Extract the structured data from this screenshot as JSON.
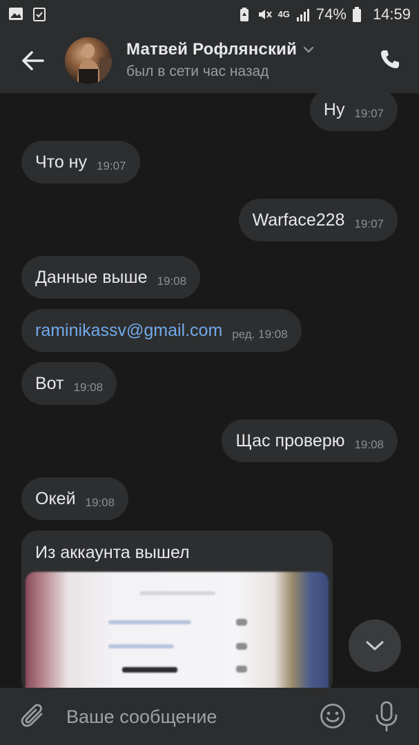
{
  "status_bar": {
    "network": "4G",
    "battery": "74%",
    "time": "14:59",
    "icons": [
      "image-icon",
      "clipboard-check-icon",
      "battery-saver-icon",
      "mute-icon",
      "data-arrows-icon",
      "signal-icon",
      "battery-icon"
    ]
  },
  "header": {
    "name": "Матвей Рофлянский",
    "status": "был в сети час назад"
  },
  "messages": [
    {
      "side": "out",
      "text": "Ну",
      "time": "19:07"
    },
    {
      "side": "in",
      "text": "Что ну",
      "time": "19:07"
    },
    {
      "side": "out",
      "text": "Warface228",
      "time": "19:07"
    },
    {
      "side": "in",
      "text": "Данные выше",
      "time": "19:08"
    },
    {
      "side": "in",
      "text": "raminikassv@gmail.com",
      "time": "ред. 19:08"
    },
    {
      "side": "in",
      "text": "Вот",
      "time": "19:08"
    },
    {
      "side": "out",
      "text": "Щас проверю",
      "time": "19:08"
    },
    {
      "side": "in",
      "text": "Окей",
      "time": "19:08"
    },
    {
      "side": "in",
      "text": "Из аккаунта вышел",
      "time": ""
    }
  ],
  "composer": {
    "placeholder": "Ваше сообщение"
  },
  "colors": {
    "background": "#19191a",
    "bar": "#2c2d2e",
    "bubble": "#2d2e2f",
    "link": "#71aaeb"
  }
}
